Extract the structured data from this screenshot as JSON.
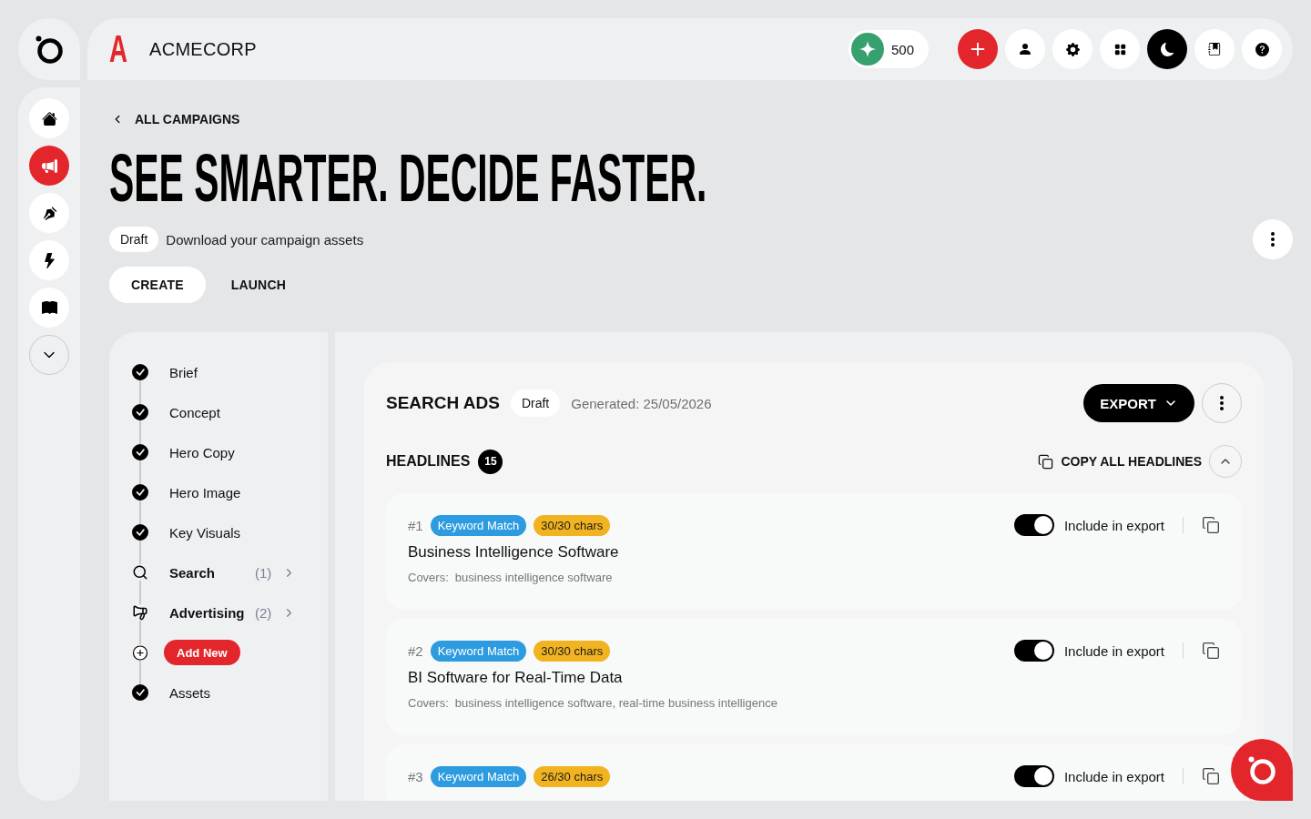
{
  "topbar": {
    "brand_letter": "A",
    "brand_name": "ACMECORP",
    "credits": "500"
  },
  "sidebar": {
    "items": [
      {
        "selected": false
      },
      {
        "selected": true
      },
      {
        "selected": false
      },
      {
        "selected": false
      },
      {
        "selected": false
      }
    ]
  },
  "back_link": "ALL CAMPAIGNS",
  "title": "SEE SMARTER. DECIDE FASTER.",
  "status_badge": "Draft",
  "subtitle": "Download your campaign assets",
  "tabs": [
    {
      "label": "CREATE",
      "selected": true
    },
    {
      "label": "LAUNCH",
      "selected": false
    }
  ],
  "steps": [
    {
      "label": "Brief",
      "kind": "done"
    },
    {
      "label": "Concept",
      "kind": "done"
    },
    {
      "label": "Hero Copy",
      "kind": "done"
    },
    {
      "label": "Hero Image",
      "kind": "done"
    },
    {
      "label": "Key Visuals",
      "kind": "done"
    },
    {
      "label": "Search",
      "kind": "search",
      "count": "(1)"
    },
    {
      "label": "Advertising",
      "kind": "ads",
      "count": "(2)"
    },
    {
      "label": "Add New",
      "kind": "add"
    },
    {
      "label": "Assets",
      "kind": "done"
    }
  ],
  "panel": {
    "title": "SEARCH ADS",
    "status": "Draft",
    "generated": "Generated: 25/05/2026",
    "export_button": "EXPORT",
    "section": {
      "title": "HEADLINES",
      "count": "15",
      "copy_all": "COPY ALL HEADLINES",
      "expanded": true
    }
  },
  "headlines": [
    {
      "number": "#1",
      "match": "Keyword Match",
      "chars": "30/30 chars",
      "include": true,
      "include_label": "Include in export",
      "text": "Business Intelligence Software",
      "covers_label": "Covers:",
      "covers": "business intelligence software"
    },
    {
      "number": "#2",
      "match": "Keyword Match",
      "chars": "30/30 chars",
      "include": true,
      "include_label": "Include in export",
      "text": "BI Software for Real-Time Data",
      "covers_label": "Covers:",
      "covers": "business intelligence software, real-time business intelligence"
    },
    {
      "number": "#3",
      "match": "Keyword Match",
      "chars": "26/30 chars",
      "include": true,
      "include_label": "Include in export"
    }
  ]
}
